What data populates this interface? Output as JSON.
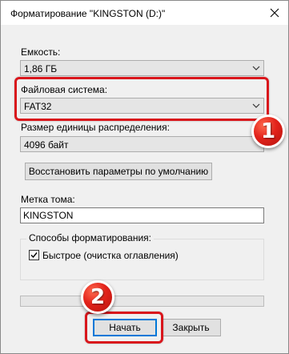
{
  "window": {
    "title": "Форматирование \"KINGSTON (D:)\""
  },
  "capacity": {
    "label": "Емкость:",
    "value": "1,86 ГБ"
  },
  "filesystem": {
    "label": "Файловая система:",
    "value": "FAT32"
  },
  "allocation": {
    "label": "Размер единицы распределения:",
    "value": "4096 байт"
  },
  "restore_defaults": {
    "label": "Восстановить параметры по умолчанию"
  },
  "volume_label": {
    "label": "Метка тома:",
    "value": "KINGSTON"
  },
  "format_options": {
    "title": "Способы форматирования:",
    "quick_format": {
      "label": "Быстрое (очистка оглавления)",
      "checked": true
    }
  },
  "progress": {
    "value": 0
  },
  "buttons": {
    "start": "Начать",
    "close": "Закрыть"
  },
  "callouts": {
    "one": "1",
    "two": "2"
  },
  "colors": {
    "highlight": "#d9161c",
    "focus_blue": "#0078d7",
    "badge_red": "#e3231b"
  }
}
